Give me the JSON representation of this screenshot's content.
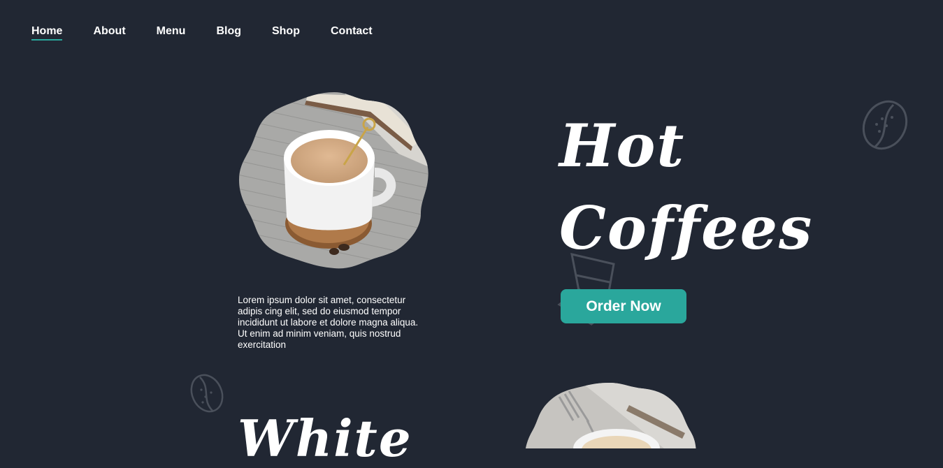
{
  "nav": {
    "items": [
      {
        "label": "Home",
        "active": true
      },
      {
        "label": "About"
      },
      {
        "label": "Menu"
      },
      {
        "label": "Blog"
      },
      {
        "label": "Shop"
      },
      {
        "label": "Contact"
      }
    ]
  },
  "hero": {
    "title_line1": "Hot",
    "title_line2": "Coffees",
    "description": "Lorem ipsum dolor sit amet, consectetur adipis cing elit, sed do eiusmod tempor incididunt ut labore et dolore magna aliqua. Ut enim ad minim veniam, quis nostrud exercitation",
    "cta_label": "Order Now"
  },
  "second_section": {
    "title": "White"
  },
  "colors": {
    "background": "#212733",
    "accent": "#2aa79c",
    "text": "#ffffff"
  },
  "icons": [
    "coffee-bean-icon",
    "coffee-bean-icon",
    "coffee-cup-outline-icon"
  ]
}
